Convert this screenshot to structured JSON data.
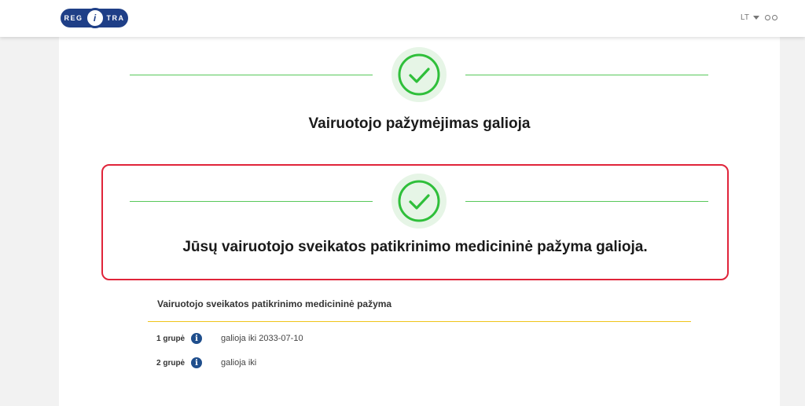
{
  "header": {
    "logo_left": "REG",
    "logo_mid": "i",
    "logo_right": "TRA",
    "language": "LT",
    "accessibility_icon": "glasses-icon"
  },
  "status": {
    "license_title": "Vairuotojo pažymėjimas galioja",
    "medical_title": "Jūsų vairuotojo sveikatos patikrinimo medicininė pažyma galioja."
  },
  "details": {
    "section_title": "Vairuotojo sveikatos patikrinimo medicininė pažyma",
    "groups": [
      {
        "label": "1 grupė",
        "info": "i",
        "value": "galioja iki 2033-07-10"
      },
      {
        "label": "2 grupė",
        "info": "i",
        "value": "galioja iki"
      }
    ]
  },
  "colors": {
    "brand": "#1f3f87",
    "success": "#2fbf3a",
    "highlight_border": "#e0243a",
    "divider": "#f0c419"
  }
}
